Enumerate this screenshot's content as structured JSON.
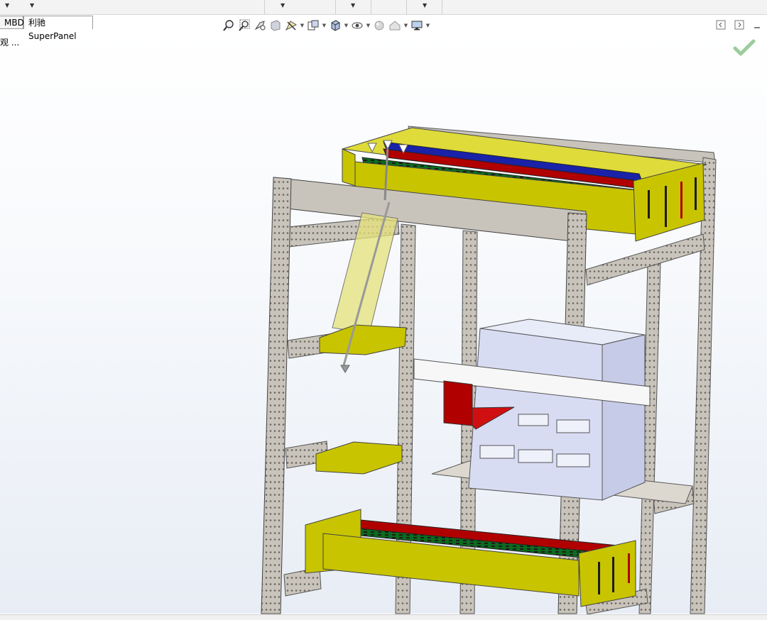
{
  "tabs": [
    {
      "label": "MBD",
      "active": false
    },
    {
      "label": "利驰SuperPanel",
      "active": true
    }
  ],
  "tree": {
    "text": "观 ..."
  },
  "icons": {
    "toolbar": [
      "zoom-to-fit-icon",
      "zoom-area-icon",
      "previous-view-icon",
      "section-view-icon",
      "dynamic-annotation-icon",
      "view-orientation-icon",
      "display-style-icon",
      "hide-show-items-icon",
      "edit-appearance-icon",
      "apply-scene-icon",
      "view-settings-icon"
    ],
    "confirm": "green-check-icon"
  },
  "colors": {
    "frame": "#c9c4bb",
    "trunking": "#c8c400",
    "busbar_red": "#b00000",
    "busbar_blue": "#1a22a8",
    "busbar_green": "#0b6b1e",
    "breaker": "#d8dcf3",
    "check": "#9ccc9c"
  }
}
